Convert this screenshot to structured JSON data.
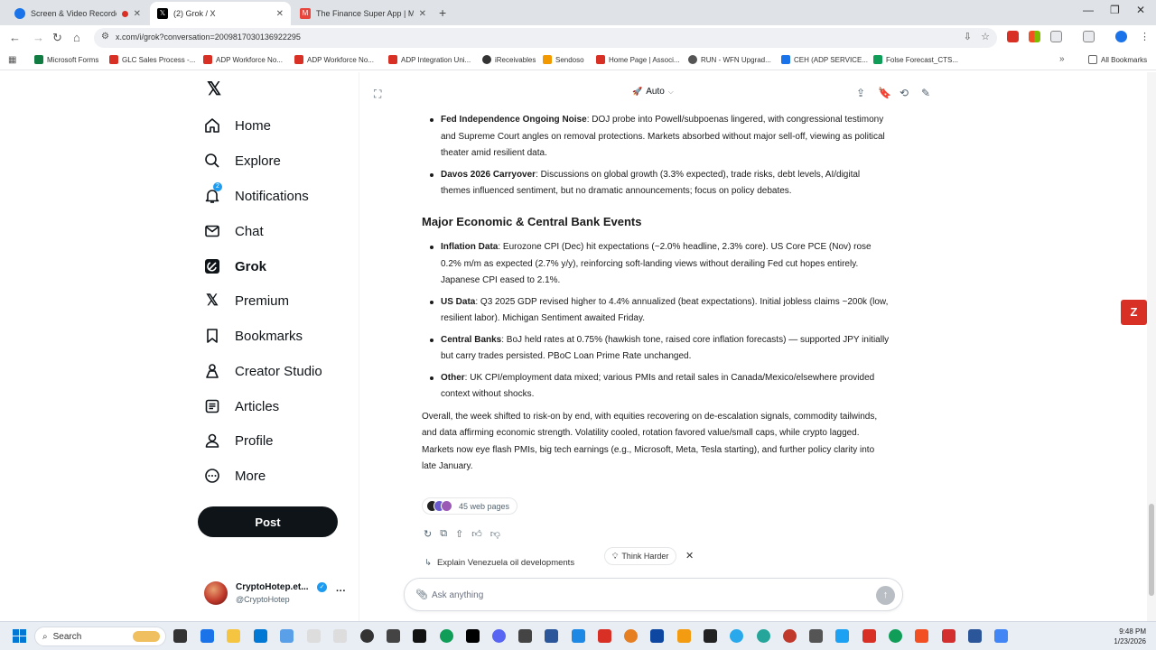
{
  "browser": {
    "tabs": [
      {
        "title": "Screen & Video Recorder | Screencastify",
        "icon": "recorder-tab-icon",
        "color": "#1a73e8"
      },
      {
        "title": "(2) Grok / X",
        "icon": "x-tab-icon",
        "color": "#000000",
        "active": true
      },
      {
        "title": "The Finance Super App | M1 Finance",
        "icon": "m1-tab-icon",
        "color": "#e8453c"
      }
    ],
    "url": "x.com/i/grok?conversation=2009817030136922295",
    "bookmarks": [
      {
        "label": "Microsoft Forms",
        "color": "#107c41"
      },
      {
        "label": "GLC Sales Process -...",
        "color": "#d93025"
      },
      {
        "label": "ADP Workforce No...",
        "color": "#d93025"
      },
      {
        "label": "ADP Workforce No...",
        "color": "#d93025"
      },
      {
        "label": "ADP Integration Uni...",
        "color": "#d93025"
      },
      {
        "label": "iReceivables",
        "color": "#333333"
      },
      {
        "label": "Sendoso",
        "color": "#f29900"
      },
      {
        "label": "Home Page | Associ...",
        "color": "#d93025"
      },
      {
        "label": "RUN - WFN Upgrad...",
        "color": "#555555"
      },
      {
        "label": "CEH (ADP SERVICE...",
        "color": "#1a73e8"
      },
      {
        "label": "Folse Forecast_CTS...",
        "color": "#0f9d58"
      }
    ],
    "all_bookmarks": "All Bookmarks"
  },
  "nav": {
    "items": [
      {
        "label": "Home",
        "icon": "home-icon"
      },
      {
        "label": "Explore",
        "icon": "search-icon"
      },
      {
        "label": "Notifications",
        "icon": "bell-icon",
        "badge": "2"
      },
      {
        "label": "Chat",
        "icon": "mail-icon"
      },
      {
        "label": "Grok",
        "icon": "grok-icon",
        "active": true
      },
      {
        "label": "Premium",
        "icon": "x-premium-icon"
      },
      {
        "label": "Bookmarks",
        "icon": "bookmark-icon"
      },
      {
        "label": "Creator Studio",
        "icon": "creator-studio-icon"
      },
      {
        "label": "Articles",
        "icon": "articles-icon"
      },
      {
        "label": "Profile",
        "icon": "person-icon"
      },
      {
        "label": "More",
        "icon": "more-circle-icon"
      }
    ],
    "post_label": "Post",
    "account": {
      "name": "CryptoHotep.et...",
      "handle": "@CryptoHotep"
    }
  },
  "grok": {
    "mode": "Auto",
    "bullets_top": [
      {
        "bold": "Fed Independence Ongoing Noise",
        "text": ": DOJ probe into Powell/subpoenas lingered, with congressional testimony and Supreme Court angles on removal protections. Markets absorbed without major sell-off, viewing as political theater amid resilient data."
      },
      {
        "bold": "Davos 2026 Carryover",
        "text": ": Discussions on global growth (3.3% expected), trade risks, debt levels, AI/digital themes influenced sentiment, but no dramatic announcements; focus on policy debates."
      }
    ],
    "heading": "Major Economic & Central Bank Events",
    "bullets_econ": [
      {
        "bold": "Inflation Data",
        "text": ": Eurozone CPI (Dec) hit expectations (~2.0% headline, 2.3% core). US Core PCE (Nov) rose 0.2% m/m as expected (2.7% y/y), reinforcing soft-landing views without derailing Fed cut hopes entirely. Japanese CPI eased to 2.1%."
      },
      {
        "bold": "US Data",
        "text": ": Q3 2025 GDP revised higher to 4.4% annualized (beat expectations). Initial jobless claims ~200k (low, resilient labor). Michigan Sentiment awaited Friday."
      },
      {
        "bold": "Central Banks",
        "text": ": BoJ held rates at 0.75% (hawkish tone, raised core inflation forecasts) — supported JPY initially but carry trades persisted. PBoC Loan Prime Rate unchanged."
      },
      {
        "bold": "Other",
        "text": ": UK CPI/employment data mixed; various PMIs and retail sales in Canada/Mexico/elsewhere provided context without shocks."
      }
    ],
    "summary": "Overall, the week shifted to risk-on by end, with equities recovering on de-escalation signals, commodity tailwinds, and data affirming economic strength. Volatility cooled, rotation favored value/small caps, while crypto lagged. Markets now eye flash PMIs, big tech earnings (e.g., Microsoft, Meta, Tesla starting), and further policy clarity into late January.",
    "sources_label": "45 web pages",
    "suggestion": "Explain Venezuela oil developments",
    "think_harder": "Think Harder",
    "ask_placeholder": "Ask anything"
  },
  "taskbar": {
    "search": "Search",
    "time": "9:48 PM",
    "date": "1/23/2026"
  }
}
